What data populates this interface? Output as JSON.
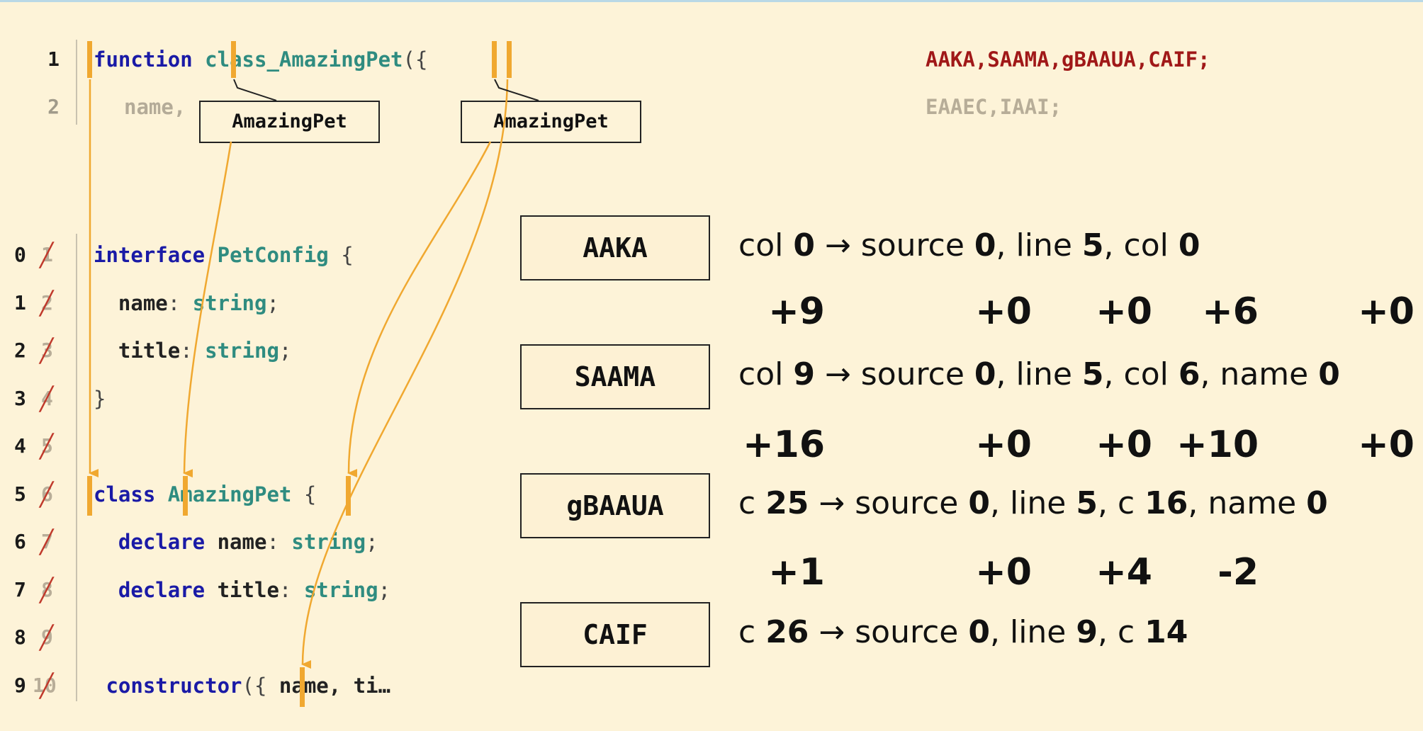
{
  "generated_code": {
    "line1": {
      "number": "1",
      "keyword": "function",
      "name": "class_AmazingPet",
      "punct": "({"
    },
    "line2": {
      "number": "2",
      "text": "name,"
    }
  },
  "mappings_text": {
    "line1": "AAKA,SAAMA,gBAAUA,CAIF;",
    "line2": "EAAEC,IAAI;"
  },
  "tooltips": [
    "AmazingPet",
    "AmazingPet"
  ],
  "source_code": {
    "lines": [
      {
        "new": "0",
        "old": "1",
        "parts": [
          [
            "kw",
            "interface"
          ],
          [
            "id",
            " "
          ],
          [
            "ty",
            "PetConfig"
          ],
          [
            "pn",
            " {"
          ]
        ]
      },
      {
        "new": "1",
        "old": "2",
        "parts": [
          [
            "id",
            "  name"
          ],
          [
            "pn",
            ": "
          ],
          [
            "ty",
            "string"
          ],
          [
            "pn",
            ";"
          ]
        ]
      },
      {
        "new": "2",
        "old": "3",
        "parts": [
          [
            "id",
            "  title"
          ],
          [
            "pn",
            ": "
          ],
          [
            "ty",
            "string"
          ],
          [
            "pn",
            ";"
          ]
        ]
      },
      {
        "new": "3",
        "old": "4",
        "parts": [
          [
            "pn",
            "}"
          ]
        ]
      },
      {
        "new": "4",
        "old": "5",
        "parts": []
      },
      {
        "new": "5",
        "old": "6",
        "parts": [
          [
            "kw",
            "class"
          ],
          [
            "id",
            " "
          ],
          [
            "ty",
            "AmazingPet"
          ],
          [
            "pn",
            " {"
          ]
        ]
      },
      {
        "new": "6",
        "old": "7",
        "parts": [
          [
            "kw",
            "  declare"
          ],
          [
            "id",
            " name"
          ],
          [
            "pn",
            ": "
          ],
          [
            "ty",
            "string"
          ],
          [
            "pn",
            ";"
          ]
        ]
      },
      {
        "new": "7",
        "old": "8",
        "parts": [
          [
            "kw",
            "  declare"
          ],
          [
            "id",
            " title"
          ],
          [
            "pn",
            ": "
          ],
          [
            "ty",
            "string"
          ],
          [
            "pn",
            ";"
          ]
        ]
      },
      {
        "new": "8",
        "old": "9",
        "parts": []
      },
      {
        "new": "9",
        "old": "10",
        "parts": [
          [
            "kw",
            " constructor"
          ],
          [
            "pn",
            "({ "
          ],
          [
            "id",
            "name, ti…"
          ]
        ]
      }
    ]
  },
  "segments": [
    {
      "label": "AAKA",
      "text": "col 0 → source 0, line 5, col 0",
      "parts": [
        [
          "t",
          "col "
        ],
        [
          "b",
          "0"
        ],
        [
          "t",
          " → source "
        ],
        [
          "b",
          "0"
        ],
        [
          "t",
          ", line "
        ],
        [
          "b",
          "5"
        ],
        [
          "t",
          ", col "
        ],
        [
          "b",
          "0"
        ]
      ]
    },
    {
      "label": "SAAMA",
      "text": "col 9 → source 0, line 5, col 6, name 0",
      "parts": [
        [
          "t",
          "col "
        ],
        [
          "b",
          "9"
        ],
        [
          "t",
          " → source "
        ],
        [
          "b",
          "0"
        ],
        [
          "t",
          ", line "
        ],
        [
          "b",
          "5"
        ],
        [
          "t",
          ", col "
        ],
        [
          "b",
          "6"
        ],
        [
          "t",
          ", name "
        ],
        [
          "b",
          "0"
        ]
      ]
    },
    {
      "label": "gBAAUA",
      "text": "c 25 → source 0, line 5, c 16, name 0",
      "parts": [
        [
          "t",
          "c "
        ],
        [
          "b",
          "25"
        ],
        [
          "t",
          " → source "
        ],
        [
          "b",
          "0"
        ],
        [
          "t",
          ", line "
        ],
        [
          "b",
          "5"
        ],
        [
          "t",
          ", c "
        ],
        [
          "b",
          "16"
        ],
        [
          "t",
          ", name "
        ],
        [
          "b",
          "0"
        ]
      ]
    },
    {
      "label": "CAIF",
      "text": "c 26 → source 0, line 9, c 14",
      "parts": [
        [
          "t",
          "c "
        ],
        [
          "b",
          "26"
        ],
        [
          "t",
          " → source "
        ],
        [
          "b",
          "0"
        ],
        [
          "t",
          ", line "
        ],
        [
          "b",
          "9"
        ],
        [
          "t",
          ", c "
        ],
        [
          "b",
          "14"
        ]
      ]
    }
  ],
  "deltas": [
    [
      "+9",
      "+0",
      "+0",
      "+6",
      "+0"
    ],
    [
      "+16",
      "+0",
      "+0",
      "+10",
      "+0"
    ],
    [
      "+1",
      "+0",
      "+4",
      "-2"
    ]
  ],
  "colors": {
    "marker": "#f0a830",
    "keyword": "#1a1aa6",
    "type": "#2f8c80",
    "mapping": "#a01818",
    "strike": "#c0392b"
  }
}
